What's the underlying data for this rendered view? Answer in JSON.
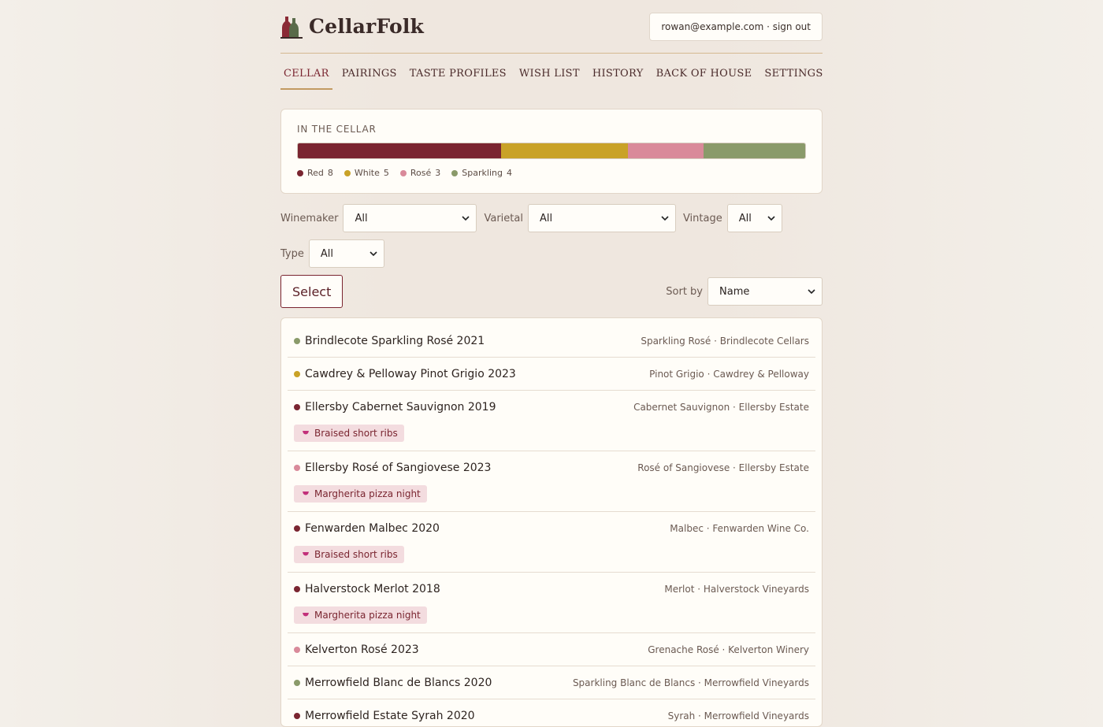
{
  "brand": {
    "name": "CellarFolk"
  },
  "account": {
    "text": "rowan@example.com · sign out"
  },
  "nav": [
    {
      "label": "CELLAR",
      "active": true
    },
    {
      "label": "PAIRINGS"
    },
    {
      "label": "TASTE PROFILES"
    },
    {
      "label": "WISH LIST"
    },
    {
      "label": "HISTORY"
    },
    {
      "label": "BACK OF HOUSE"
    },
    {
      "label": "SETTINGS"
    }
  ],
  "summary": {
    "title": "IN THE CELLAR",
    "segments": [
      {
        "label": "Red",
        "count": "8",
        "color": "#7a2530"
      },
      {
        "label": "White",
        "count": "5",
        "color": "#c9a227"
      },
      {
        "label": "Rosé",
        "count": "3",
        "color": "#d98a9a"
      },
      {
        "label": "Sparkling",
        "count": "4",
        "color": "#8a9a6a"
      }
    ]
  },
  "filters": {
    "winemaker": {
      "label": "Winemaker",
      "value": "All"
    },
    "varietal": {
      "label": "Varietal",
      "value": "All"
    },
    "vintage": {
      "label": "Vintage",
      "value": "All"
    },
    "type": {
      "label": "Type",
      "value": "All"
    }
  },
  "actions": {
    "select_label": "Select",
    "sort_label": "Sort by",
    "sort_value": "Name"
  },
  "wines": [
    {
      "name": "Brindlecote Sparkling Rosé 2021",
      "meta": "Sparkling Rosé · Brindlecote Cellars",
      "color": "#8a9a6a"
    },
    {
      "name": "Cawdrey & Pelloway Pinot Grigio 2023",
      "meta": "Pinot Grigio · Cawdrey & Pelloway",
      "color": "#c9a227"
    },
    {
      "name": "Ellersby Cabernet Sauvignon 2019",
      "meta": "Cabernet Sauvignon · Ellersby Estate",
      "color": "#7a2530",
      "tag": "Braised short ribs"
    },
    {
      "name": "Ellersby Rosé of Sangiovese 2023",
      "meta": "Rosé of Sangiovese · Ellersby Estate",
      "color": "#d98a9a",
      "tag": "Margherita pizza night"
    },
    {
      "name": "Fenwarden Malbec 2020",
      "meta": "Malbec · Fenwarden Wine Co.",
      "color": "#7a2530",
      "tag": "Braised short ribs"
    },
    {
      "name": "Halverstock Merlot 2018",
      "meta": "Merlot · Halverstock Vineyards",
      "color": "#7a2530",
      "tag": "Margherita pizza night"
    },
    {
      "name": "Kelverton Rosé 2023",
      "meta": "Grenache Rosé · Kelverton Winery",
      "color": "#d98a9a"
    },
    {
      "name": "Merrowfield Blanc de Blancs 2020",
      "meta": "Sparkling Blanc de Blancs · Merrowfield Vineyards",
      "color": "#8a9a6a"
    },
    {
      "name": "Merrowfield Estate Syrah 2020",
      "meta": "Syrah · Merrowfield Vineyards",
      "color": "#7a2530"
    }
  ]
}
